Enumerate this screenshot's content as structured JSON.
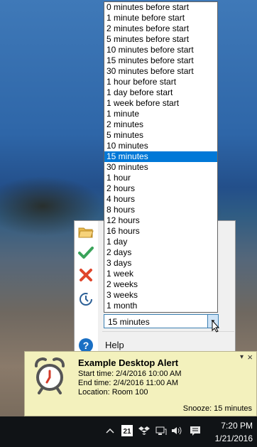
{
  "dropdown": {
    "options": [
      "0 minutes before start",
      "1 minute before start",
      "2 minutes before start",
      "5 minutes before start",
      "10 minutes before start",
      "15 minutes before start",
      "30 minutes before start",
      "1 hour before start",
      "1 day before start",
      "1 week before start",
      "1 minute",
      "2 minutes",
      "5 minutes",
      "10 minutes",
      "15 minutes",
      "30 minutes",
      "1 hour",
      "2 hours",
      "4 hours",
      "8 hours",
      "12 hours",
      "16 hours",
      "1 day",
      "2 days",
      "3 days",
      "1 week",
      "2 weeks",
      "3 weeks",
      "1 month"
    ],
    "selected_index": 14
  },
  "combo": {
    "value": "15 minutes"
  },
  "panel": {
    "help_label": "Help",
    "icons": [
      "folder-icon",
      "checkmark-icon",
      "dismiss-x-icon",
      "snooze-clock-icon",
      "help-icon"
    ]
  },
  "alert": {
    "title": "Example Desktop Alert",
    "start": "Start time: 2/4/2016 10:00 AM",
    "end": "End time: 2/4/2016 11:00 AM",
    "location": "Location: Room 100",
    "snooze": "Snooze: 15 minutes",
    "dropdown_glyph": "▾",
    "close_glyph": "×"
  },
  "taskbar": {
    "time": "7:20 PM",
    "date": "1/21/2016",
    "calendar_day": "21",
    "tray_icons": [
      "chevron-up-icon",
      "calendar-icon",
      "dropbox-icon",
      "network-icon",
      "volume-icon",
      "notification-icon"
    ]
  }
}
